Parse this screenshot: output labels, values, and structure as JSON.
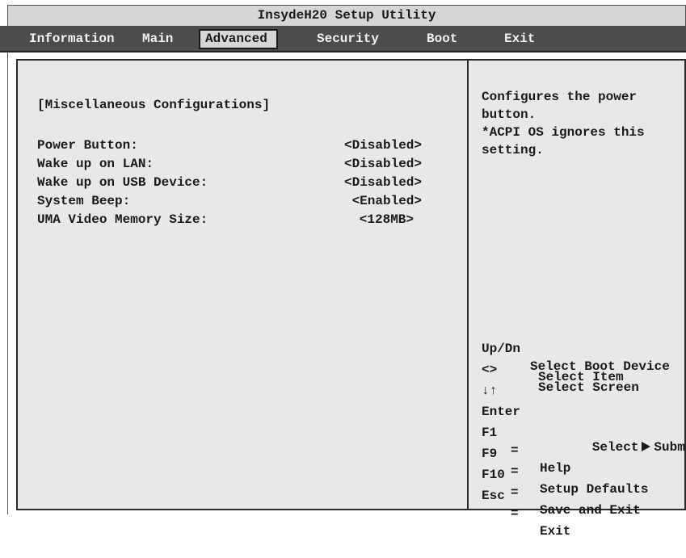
{
  "window": {
    "title": "InsydeH20 Setup Utility"
  },
  "menu": {
    "tabs": [
      {
        "label": "Information"
      },
      {
        "label": "Main"
      },
      {
        "label": "Advanced"
      },
      {
        "label": "Security"
      },
      {
        "label": "Boot"
      },
      {
        "label": "Exit"
      }
    ],
    "active": "Advanced"
  },
  "section": {
    "heading": "[Miscellaneous Configurations]"
  },
  "settings": [
    {
      "label": "Power Button:",
      "value": "<Disabled>"
    },
    {
      "label": "Wake up on LAN:",
      "value": "<Disabled>"
    },
    {
      "label": "Wake up on USB Device:",
      "value": "<Disabled>"
    },
    {
      "label": "System Beep:",
      "value": "<Enabled>"
    },
    {
      "label": "UMA Video Memory Size:",
      "value": "<128MB>"
    }
  ],
  "help": {
    "lines": [
      "Configures the power",
      "button.",
      "*ACPI OS ignores this",
      "setting."
    ]
  },
  "keys": {
    "updn": {
      "key": "Up/Dn",
      "desc": "Select Boot Device"
    },
    "lr": {
      "key": "<>",
      "desc": "Select Screen"
    },
    "arrows": {
      "key": "↓↑",
      "desc": "Select Item"
    },
    "enter": {
      "key": "Enter",
      "desc_a": "Select",
      "desc_b": "Submenu"
    },
    "f1": {
      "key": "F1",
      "eq": "=",
      "desc": "Help"
    },
    "f9": {
      "key": "F9",
      "eq": "=",
      "desc": "Setup Defaults"
    },
    "f10": {
      "key": "F10",
      "eq": "=",
      "desc": "Save and Exit"
    },
    "esc": {
      "key": "Esc",
      "eq": "=",
      "desc": "Exit"
    }
  },
  "colors": {
    "menubar": "#4d4d4d",
    "panel": "#e8e8e8",
    "titlebar": "#d6d6d6"
  }
}
